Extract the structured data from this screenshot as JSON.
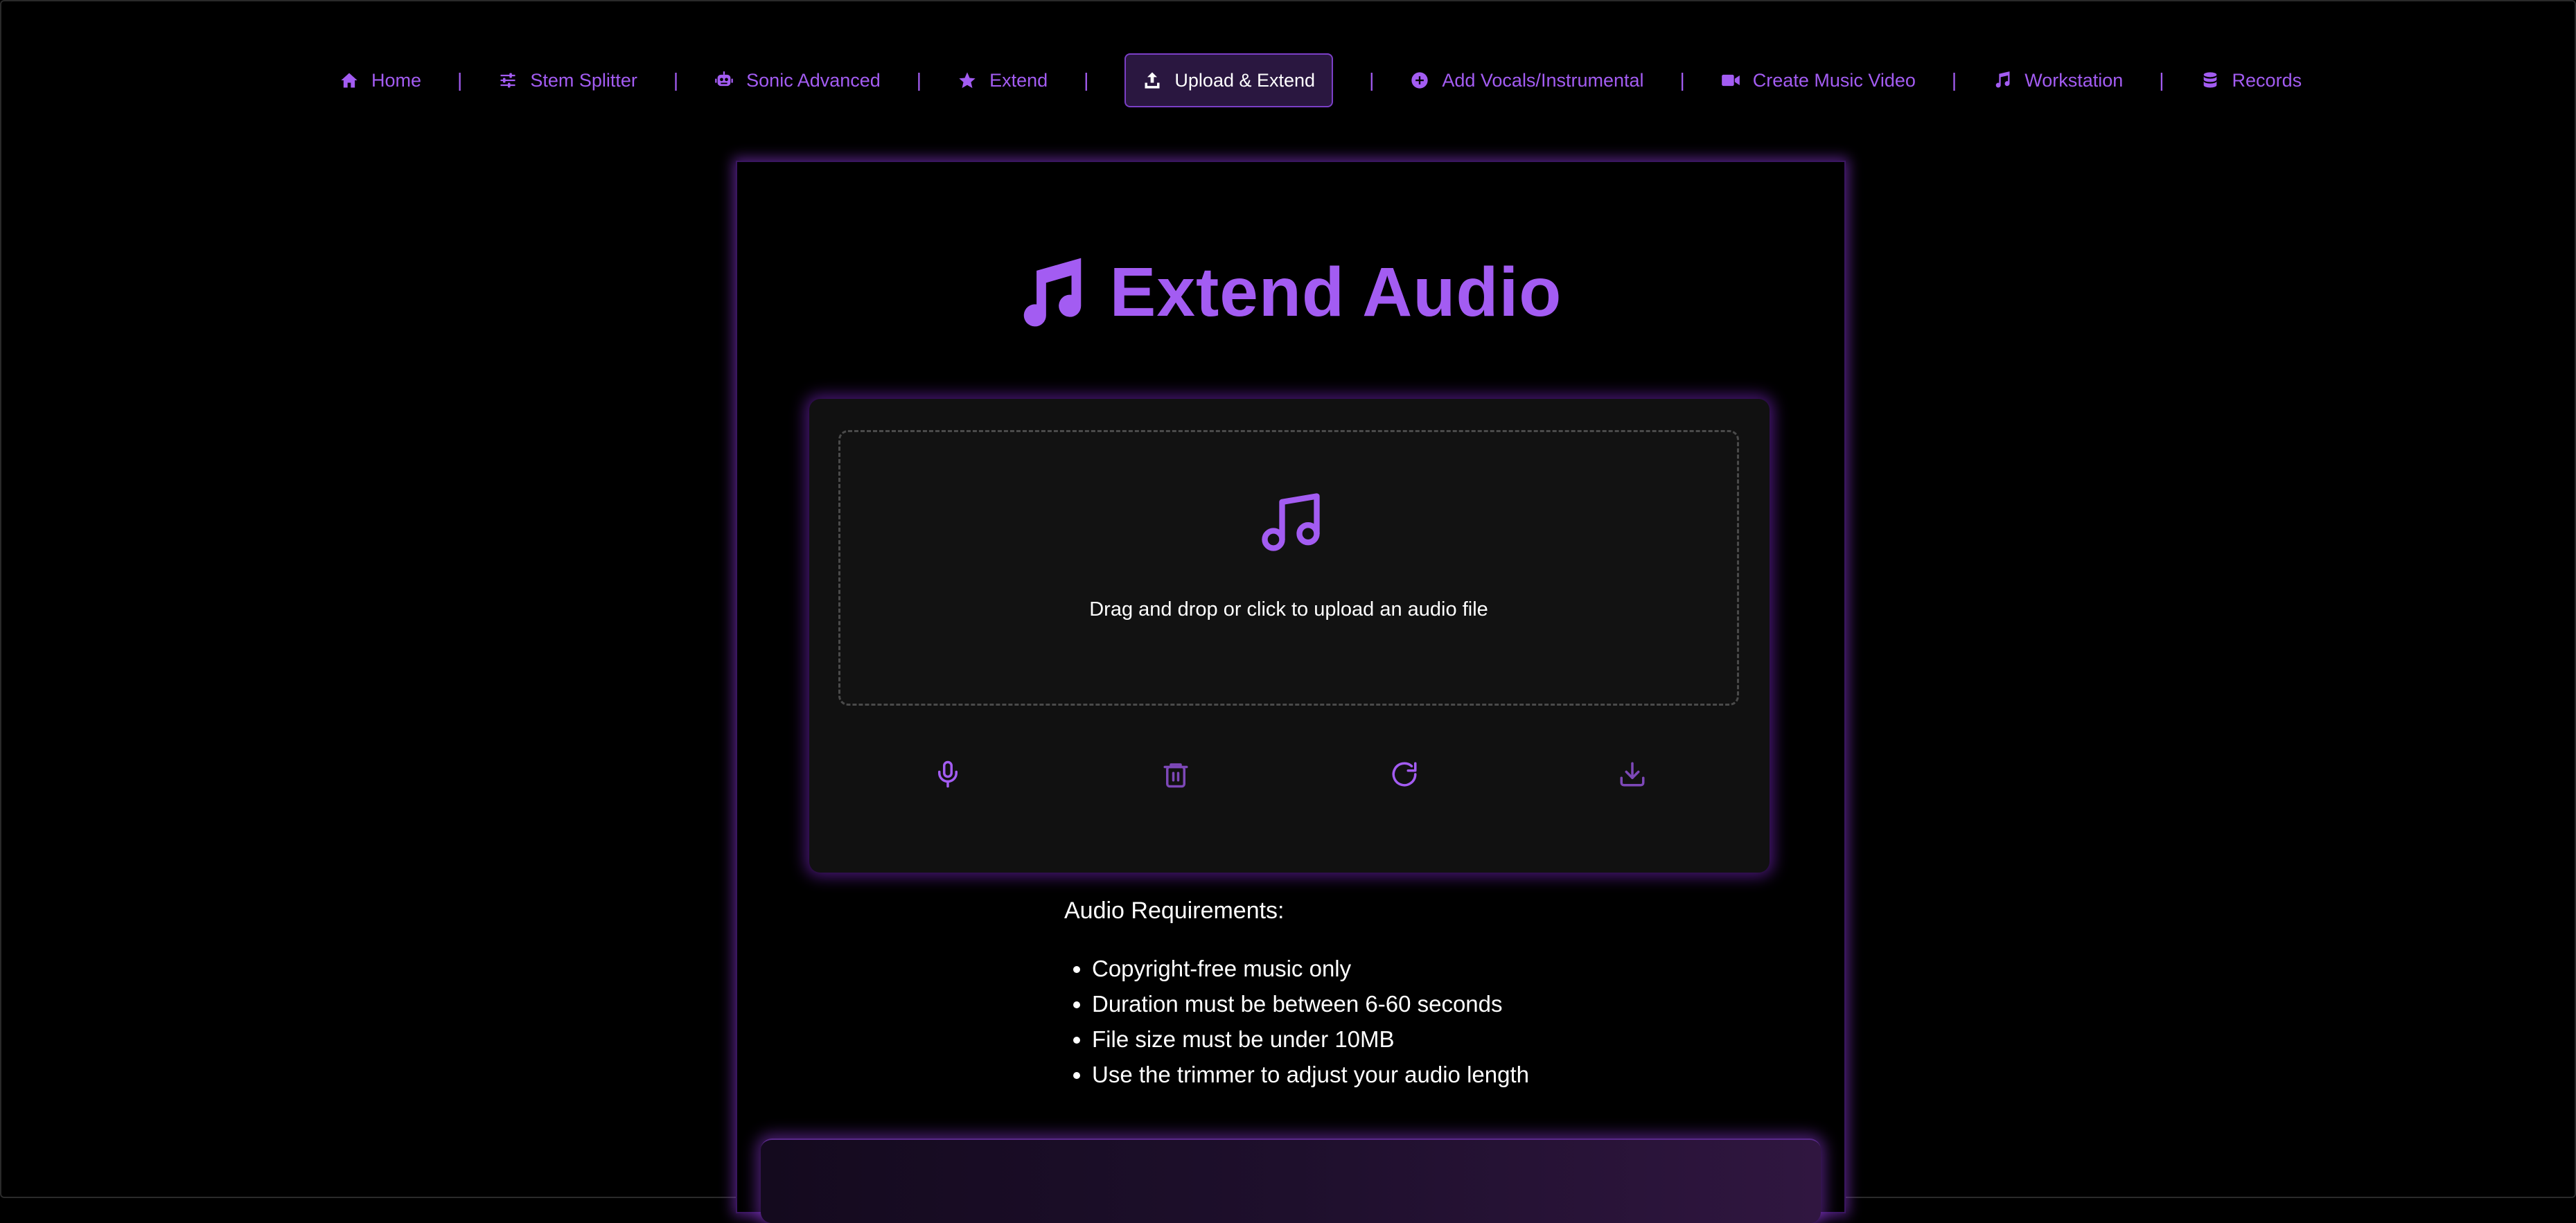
{
  "nav": {
    "items": [
      {
        "label": "Home",
        "icon": "home-icon"
      },
      {
        "label": "Stem Splitter",
        "icon": "sliders-icon"
      },
      {
        "label": "Sonic Advanced",
        "icon": "robot-icon"
      },
      {
        "label": "Extend",
        "icon": "star-icon"
      },
      {
        "label": "Upload & Extend",
        "icon": "upload-icon",
        "active": true
      },
      {
        "label": "Add Vocals/Instrumental",
        "icon": "plus-circle-icon"
      },
      {
        "label": "Create Music Video",
        "icon": "video-icon"
      },
      {
        "label": "Workstation",
        "icon": "music-note-icon"
      },
      {
        "label": "Records",
        "icon": "database-icon"
      }
    ],
    "separator": "|"
  },
  "main": {
    "title": "Extend Audio",
    "dropzone_text": "Drag and drop or click to upload an audio file",
    "tools": [
      "microphone-icon",
      "trash-icon",
      "refresh-icon",
      "download-icon"
    ]
  },
  "requirements": {
    "heading": "Audio Requirements:",
    "items": [
      "Copyright-free music only",
      "Duration must be between 6-60 seconds",
      "File size must be under 10MB",
      "Use the trimmer to adjust your audio length"
    ]
  },
  "colors": {
    "accent": "#a35cf2",
    "background": "#000000",
    "panel": "#111111"
  }
}
